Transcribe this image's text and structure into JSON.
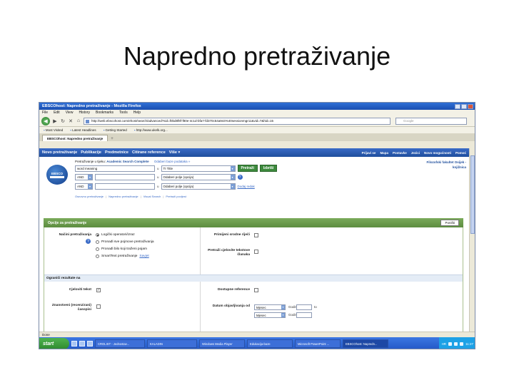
{
  "slide": {
    "title": "Napredno pretraživanje"
  },
  "window": {
    "title": "EBSCOhost: Napredno pretraživanje - Mozilla Firefox"
  },
  "menu": [
    "File",
    "Edit",
    "View",
    "History",
    "Bookmarks",
    "Tools",
    "Help"
  ],
  "address": {
    "url": "http://web.ebscohost.com/ehost/search/advanced?sid=f0bd8f8f-f80e-4c1d-bfa7-fd370c54a944%40sessionmgr11&vid=7&hid=15",
    "search_placeholder": "Google"
  },
  "bookmarks": [
    "Most Visited",
    "Latest Headlines",
    "Getting Started",
    "http://www.ukelk.org..."
  ],
  "tab": {
    "label": "EBSCOhost: Napredno pretraživanje",
    "plus": "+"
  },
  "bluenav": {
    "items": [
      "Novo pretraživanje",
      "Publikacije",
      "Predmetnice",
      "Citirane reference",
      "Više"
    ],
    "more_arrow": "▾",
    "right": [
      "Prijavi se",
      "Mapa",
      "Postavke",
      "Jezici",
      "Novo mogućnosti",
      "Pomoć"
    ]
  },
  "search": {
    "db_prefix": "Pretraživanje u tijeku:",
    "db_name": "Academic Search Complete",
    "db_choose": "Odaberi baze podataka »",
    "row1": {
      "term": "word meaning",
      "in": "u",
      "field": "TI Title"
    },
    "row2": {
      "op": "AND",
      "term": "",
      "in": "u",
      "field": "Odaberi polje (opcija)"
    },
    "row3": {
      "op": "AND",
      "term": "",
      "in": "u",
      "field": "Odaberi polje (opcija)"
    },
    "search_btn": "Pretraži",
    "clear_btn": "Izbriši",
    "help": "?",
    "add_row": "Dodaj redak",
    "institution": "Filozofski fakultet Osijek - knjižnica",
    "sublinks": [
      "Osnovno pretraživanje",
      "Napredno pretraživanje",
      "Visual Search",
      "Pretraži povijest"
    ],
    "logo_text": "EBSCO"
  },
  "options": {
    "header": "Opcije za pretraživanje",
    "reset": "Poništi",
    "mode_label": "Načini pretraživanja",
    "modes": [
      "Logički operatori/izraz",
      "Pronađi sve pojmove pretraživanja",
      "Pronađi bilo koji traženi pojam",
      "SmartText pretraživanje"
    ],
    "hint_link": "Savjet",
    "related_words": "Primijeni srodne riječi",
    "fulltext_articles": "Pretraži cjelovite tekstove članaka"
  },
  "limits": {
    "header": "Ograniči rezultate na",
    "full_text": "Cjeloviti tekst",
    "check_mark": "✓",
    "references": "Dostupne reference",
    "peer_reviewed": "Znanstveni (recenzirani) časopisi",
    "pub_date": "Datum objavljivanja od",
    "month": "Mjesec",
    "year": "Godina:",
    "to": "to"
  },
  "status": {
    "text": "Done"
  },
  "taskbar": {
    "start": "start",
    "tasks": [
      "CROLIST - Jednostav...",
      "KALADIN",
      "Windows Media Player",
      "Edukacija-baze",
      "Microsoft PowerPoint ...",
      "EBSCOhost: Napredn..."
    ],
    "lang": "HR",
    "clock": "11:27"
  },
  "icons": {
    "back": "back-arrow-icon",
    "forward": "forward-arrow-icon",
    "reload": "reload-icon",
    "stop": "stop-icon",
    "home": "home-icon"
  }
}
